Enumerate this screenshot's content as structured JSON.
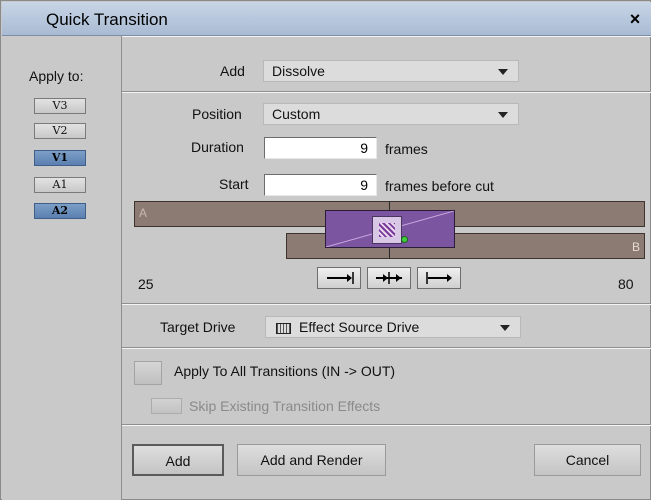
{
  "window": {
    "title": "Quick Transition",
    "close_glyph": "×"
  },
  "apply_to": {
    "label": "Apply to:",
    "tracks": [
      {
        "label": "V3",
        "selected": false
      },
      {
        "label": "V2",
        "selected": false
      },
      {
        "label": "V1",
        "selected": true
      },
      {
        "label": "A1",
        "selected": false
      },
      {
        "label": "A2",
        "selected": true
      }
    ]
  },
  "add": {
    "label": "Add",
    "value": "Dissolve"
  },
  "position": {
    "label": "Position",
    "value": "Custom"
  },
  "duration": {
    "label": "Duration",
    "value": "9",
    "unit": "frames"
  },
  "start": {
    "label": "Start",
    "value": "9",
    "unit": "frames before cut"
  },
  "timeline": {
    "clip_a_label": "A",
    "clip_b_label": "B",
    "range_start": "25",
    "range_end": "80",
    "nav_buttons": [
      "end-before-cut",
      "center-on-cut",
      "start-at-cut"
    ]
  },
  "target_drive": {
    "label": "Target Drive",
    "value": "Effect Source Drive",
    "icon": "drive-icon"
  },
  "apply_all": {
    "label": "Apply To All Transitions (IN -> OUT)",
    "checked": false
  },
  "skip_existing": {
    "label": "Skip Existing Transition Effects",
    "checked": false,
    "enabled": false
  },
  "buttons": {
    "add": "Add",
    "add_render": "Add and Render",
    "cancel": "Cancel"
  },
  "colors": {
    "title_bar": "#b3c3d9",
    "panel": "#c9c9c9",
    "clip": "#8c7b72",
    "effect": "#7c55a0",
    "selected_track": "#6a8cbf"
  }
}
